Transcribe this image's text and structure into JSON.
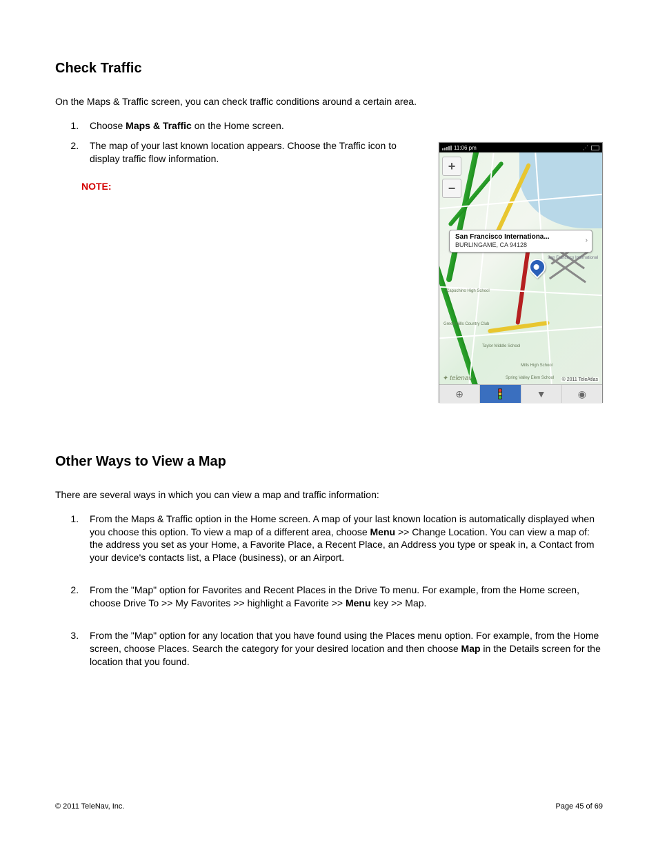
{
  "section1": {
    "heading": "Check Traffic",
    "intro": "On the Maps & Traffic screen, you can check traffic conditions around a certain area.",
    "step1_pre": "Choose ",
    "step1_bold": "Maps & Traffic",
    "step1_post": " on the Home screen.",
    "step2": "The map of your last known location appears. Choose the Traffic icon to display traffic flow information.",
    "note_label": "NOTE:"
  },
  "screenshot": {
    "time": "11:06 pm",
    "zoom_in": "+",
    "zoom_out": "−",
    "callout_title": "San Francisco Internationa...",
    "callout_sub": "BURLINGAME, CA 94128",
    "brand": "telenav",
    "copyright": "© 2011 TeleAtlas",
    "labels": {
      "capuchino": "Capuchino High School",
      "greenhills": "Green Hills Country Club",
      "taylor": "Taylor Middle School",
      "mills": "Mills High School",
      "spring": "Spring Valley Elem School",
      "sfo": "San Francisco International"
    }
  },
  "section2": {
    "heading": "Other Ways to View a Map",
    "intro": "There are several ways in which you can view a map and traffic information:",
    "item1_a": "From the Maps & Traffic option in the Home screen. A map of your last known location is automatically displayed when you choose this option. To view a map of a different area, choose ",
    "item1_bold": "Menu",
    "item1_b": " >> Change Location. You can view a map of: the address you set as your Home, a Favorite Place, a Recent Place, an Address you type or speak in, a Contact from your device's contacts list, a Place (business), or an Airport.",
    "item2_a": "From the \"Map\" option for Favorites and Recent Places in the Drive To menu. For example, from the Home screen, choose Drive To >> My Favorites >> highlight a Favorite >> ",
    "item2_bold": "Menu",
    "item2_b": " key >> Map.",
    "item3_a": "From the \"Map\" option for any location that you have found using the Places menu option. For example, from the Home screen, choose Places. Search the category for your desired location and then choose ",
    "item3_bold": "Map",
    "item3_b": " in the Details screen for the location that you found."
  },
  "footer": {
    "copyright": "© 2011 TeleNav, Inc.",
    "page": "Page 45 of 69"
  }
}
